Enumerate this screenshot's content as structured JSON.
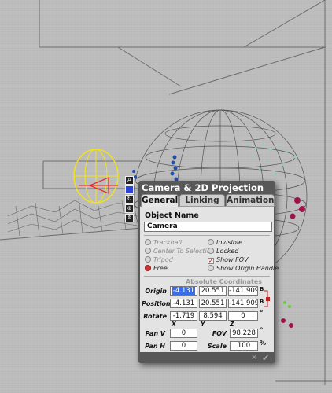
{
  "panel": {
    "title": "Camera & 2D Projection",
    "tabs": [
      {
        "label": "General",
        "active": true
      },
      {
        "label": "Linking",
        "active": false
      },
      {
        "label": "Animation",
        "active": false
      }
    ],
    "object_name_label": "Object Name",
    "object_name_value": "Camera",
    "modes": [
      {
        "label": "Trackball",
        "enabled": false,
        "selected": false
      },
      {
        "label": "Center To Selection",
        "enabled": false,
        "selected": false
      },
      {
        "label": "Tripod",
        "enabled": false,
        "selected": false
      },
      {
        "label": "Free",
        "enabled": true,
        "selected": true
      }
    ],
    "flags": [
      {
        "label": "Invisible",
        "checked": false
      },
      {
        "label": "Locked",
        "checked": false
      },
      {
        "label": "Show FOV",
        "checked": true
      },
      {
        "label": "Show Origin Handle",
        "checked": false
      }
    ],
    "abs_coords_label": "Absolute Coordinates",
    "origin": {
      "label": "Origin",
      "x": "-4.131",
      "y": "20.551",
      "z": "-141.909"
    },
    "position": {
      "label": "Position",
      "x": "-4.131",
      "y": "20.551",
      "z": "-141.909"
    },
    "rotate": {
      "label": "Rotate",
      "x": "-1.719",
      "y": "8.594",
      "z": "0",
      "unit": "°"
    },
    "axis_labels": {
      "x": "X",
      "y": "Y",
      "z": "Z"
    },
    "side_labels": {
      "origin": "B",
      "position": "B"
    },
    "pan_v": {
      "label": "Pan V",
      "value": "0"
    },
    "pan_h": {
      "label": "Pan H",
      "value": "0"
    },
    "fov": {
      "label": "FOV",
      "value": "98.228",
      "unit": "°"
    },
    "scale": {
      "label": "Scale",
      "value": "100",
      "unit": "%"
    }
  },
  "colors": {
    "panel_bg": "#585858",
    "content_bg": "#e3e3e3",
    "selection": "#3a6ee8",
    "camera_gizmo": "#f2e21a",
    "wire": "#5a5a5a",
    "points_blue": "#1f4fb0",
    "points_cyan": "#7fd2c8",
    "points_magenta": "#a0124a",
    "points_green": "#6bcc3a"
  },
  "icons": [
    "camera-gizmo-icon",
    "camera-tool-icon",
    "close-icon",
    "ok-check-icon"
  ]
}
